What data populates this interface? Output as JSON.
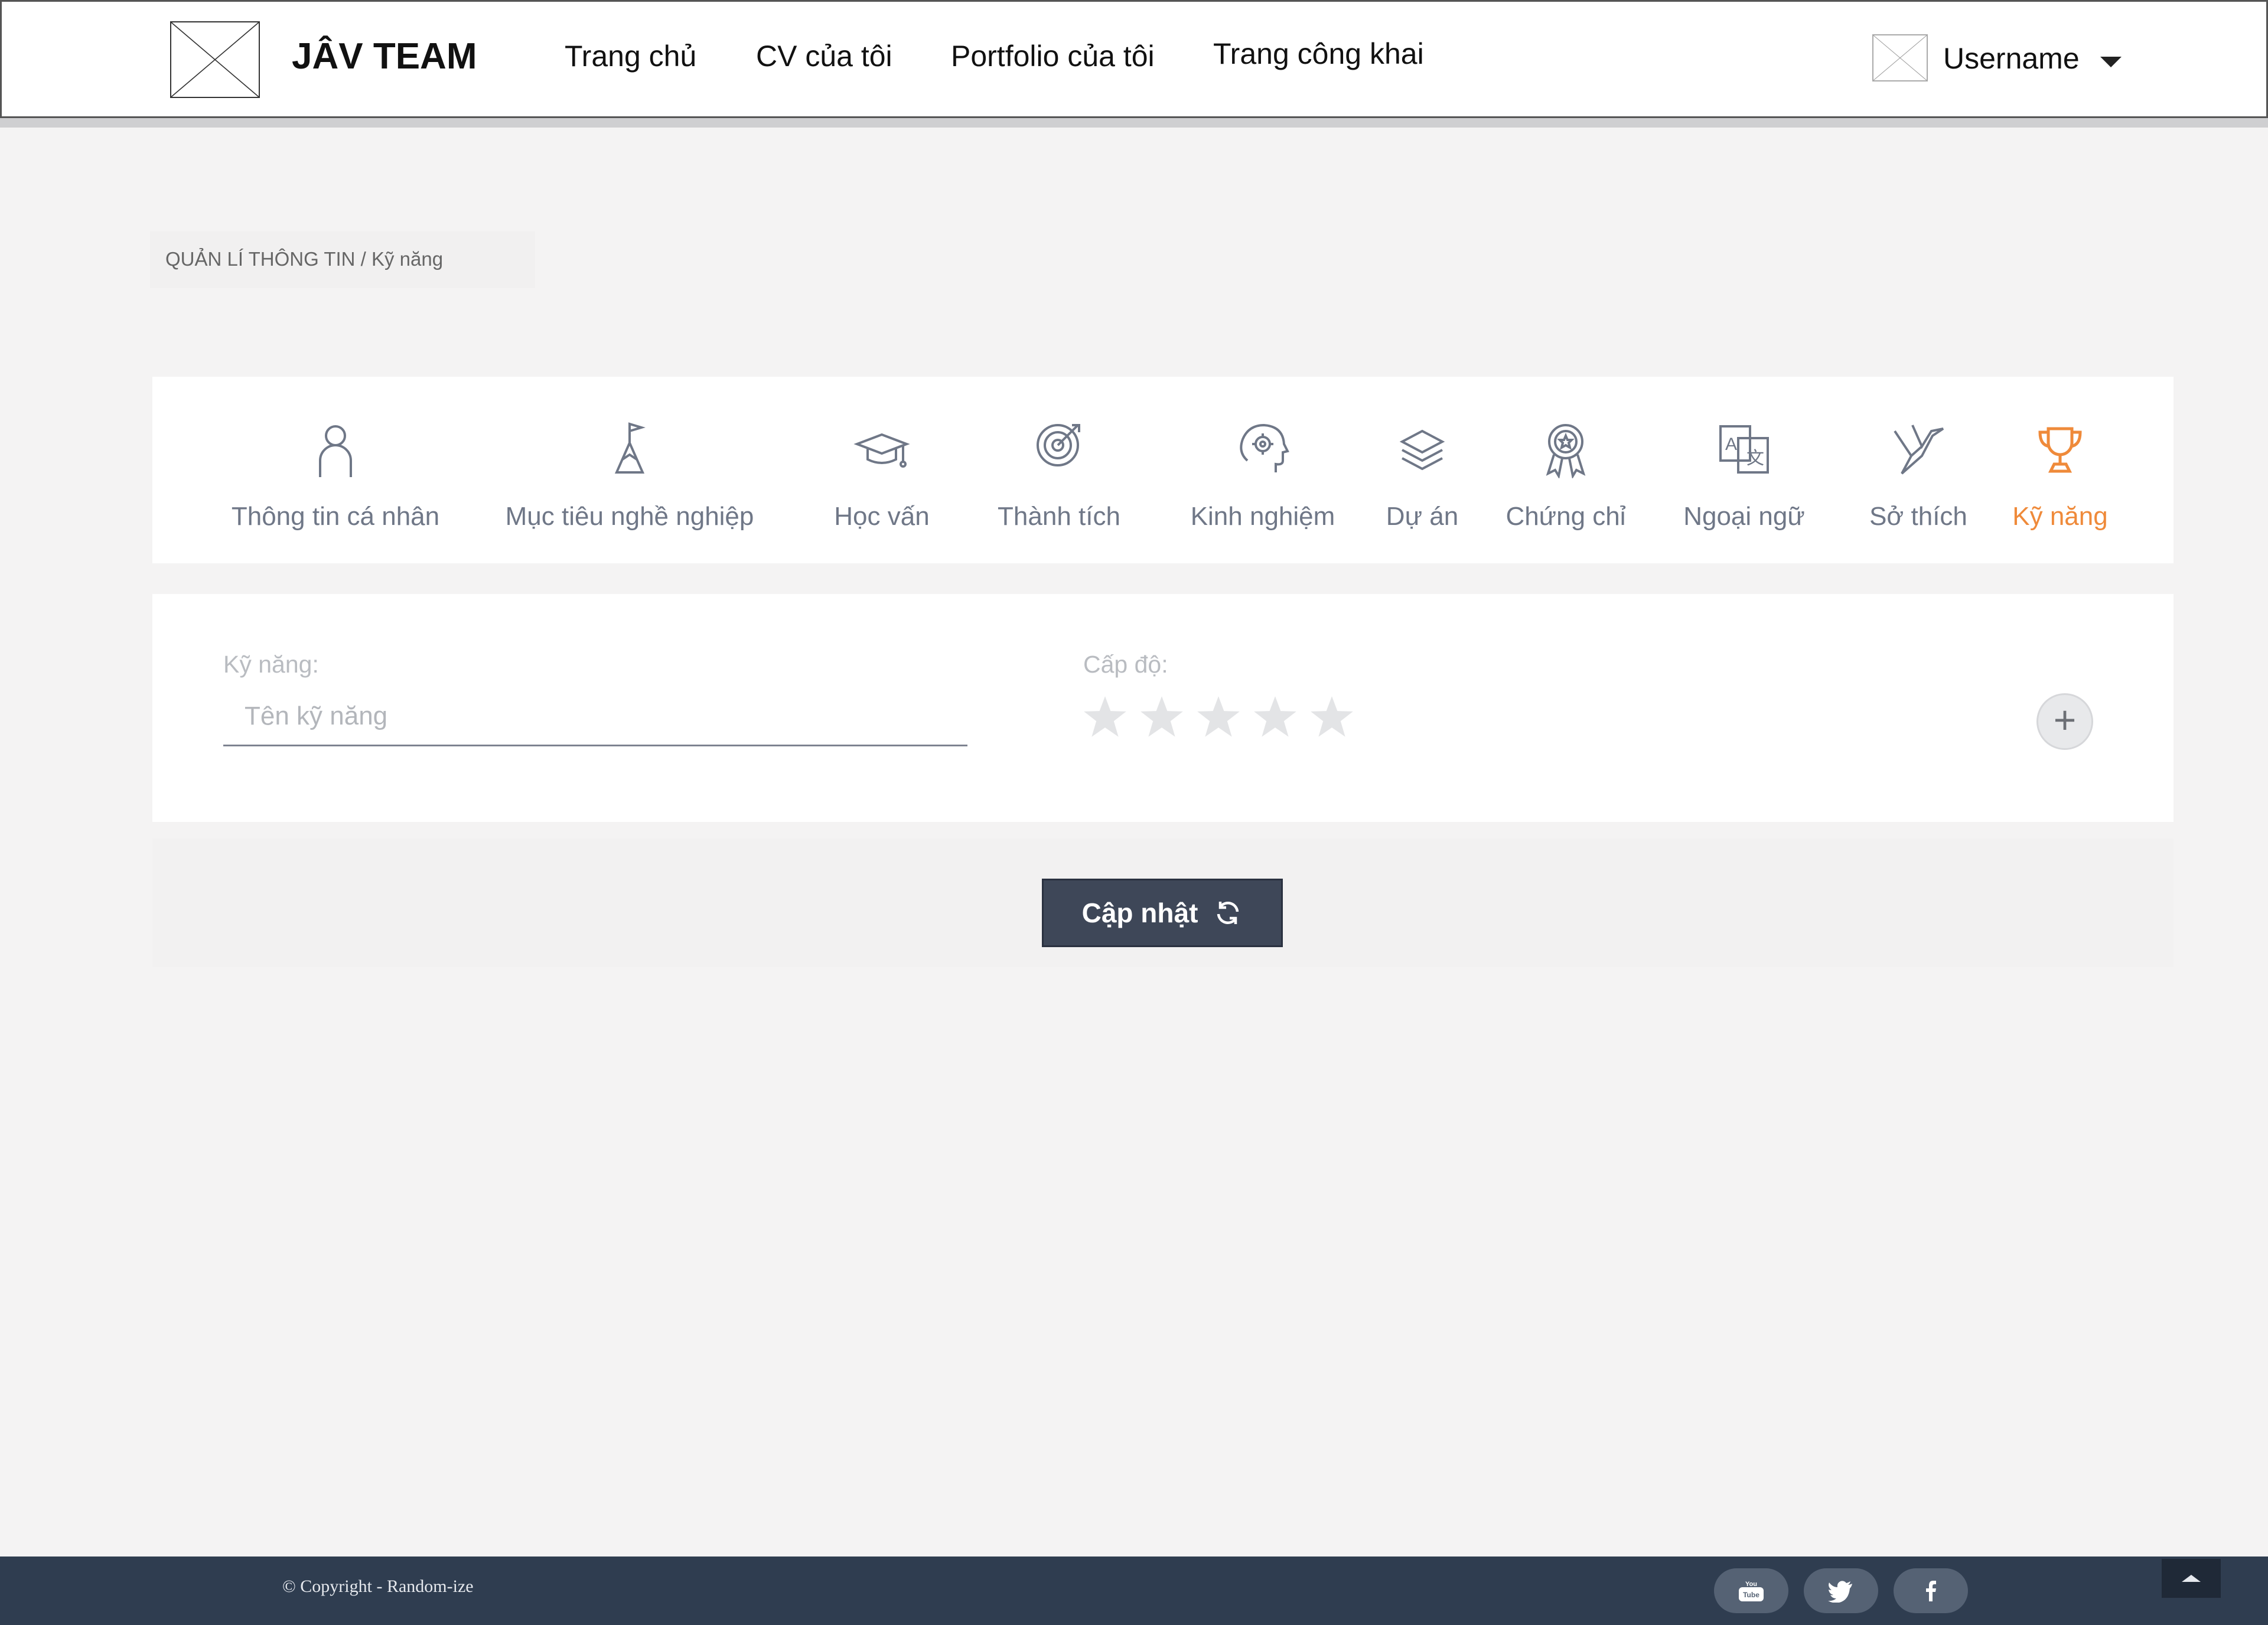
{
  "header": {
    "brand": "JÂV TEAM",
    "nav": [
      "Trang chủ",
      "CV của tôi",
      "Portfolio của tôi",
      "Trang công khai"
    ],
    "username": "Username"
  },
  "breadcrumb": "QUẢN LÍ THÔNG TIN / Kỹ năng",
  "tabs": [
    {
      "label": "Thông tin cá nhân",
      "icon": "user-icon"
    },
    {
      "label": "Mục tiêu nghề nghiệp",
      "icon": "flag-mountain-icon"
    },
    {
      "label": "Học vấn",
      "icon": "graduation-cap-icon"
    },
    {
      "label": "Thành tích",
      "icon": "target-icon"
    },
    {
      "label": "Kinh nghiệm",
      "icon": "brain-gear-icon"
    },
    {
      "label": "Dự án",
      "icon": "layers-icon"
    },
    {
      "label": "Chứng chỉ",
      "icon": "award-icon"
    },
    {
      "label": "Ngoại ngữ",
      "icon": "translate-icon"
    },
    {
      "label": "Sở thích",
      "icon": "origami-bird-icon"
    },
    {
      "label": "Kỹ năng",
      "icon": "trophy-icon"
    }
  ],
  "active_tab": "Kỹ năng",
  "form": {
    "skill_label": "Kỹ năng:",
    "skill_placeholder": "Tên kỹ năng",
    "skill_value": "",
    "level_label": "Cấp độ:",
    "level_value": 0,
    "level_max": 5,
    "add_symbol": "+"
  },
  "update_label": "Cập nhật",
  "footer": {
    "copyright": "© Copyright - Random-ize",
    "socials": [
      "youtube-icon",
      "twitter-icon",
      "facebook-icon"
    ]
  },
  "colors": {
    "accent": "#ef8a3a",
    "footer_bg": "#2f3d50",
    "button_bg": "#3e4758",
    "icon_gray": "#6f7787",
    "star_empty": "#e3e4e6"
  }
}
